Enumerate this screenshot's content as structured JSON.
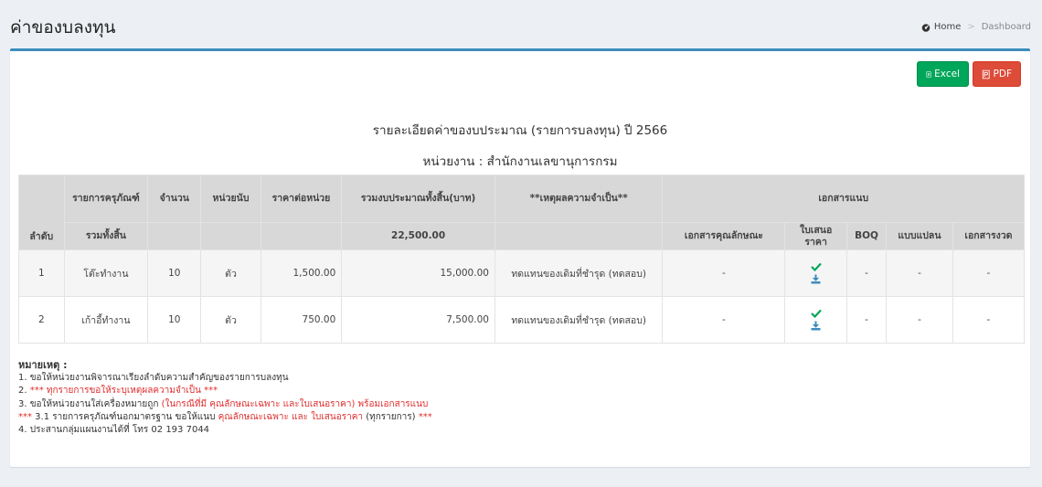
{
  "header": {
    "title": "ค่าของบลงทุน",
    "breadcrumb": [
      "Home",
      "Dashboard"
    ]
  },
  "actions": {
    "excel": "Excel",
    "pdf": "PDF"
  },
  "report": {
    "title": "รายละเอียดค่าของบประมาณ (รายการบลงทุน) ปี 2566",
    "unit": "หน่วยงาน : สำนักงานเลขานุการกรม"
  },
  "table": {
    "headers": {
      "item": "รายการครุภัณฑ์",
      "qty": "จำนวน",
      "unit": "หน่วยนับ",
      "price": "ราคาต่อหน่วย",
      "budget": "รวมงบประมาณทั้งสิ้น(บาท)",
      "reason": "**เหตุผลความจำเป็น**",
      "attachments": "เอกสารแนบ",
      "seq": "ลำดับ",
      "total_label": "รวมทั้งสิ้น",
      "total_value": "22,500.00",
      "doc_spec": "เอกสารคุณลักษณะ",
      "doc_quote": "ใบเสนอราคา",
      "doc_boq": "BOQ",
      "doc_plan": "แบบแปลน",
      "doc_other": "เอกสารงวด"
    },
    "rows": [
      {
        "seq": "1",
        "item": "โต๊ะทำงาน",
        "qty": "10",
        "unit": "ตัว",
        "price": "1,500.00",
        "budget": "15,000.00",
        "reason": "ทดแทนของเดิมที่ชำรุด (ทดสอบ)",
        "doc_spec": "-",
        "doc_boq": "-",
        "doc_plan": "-",
        "doc_other": "-"
      },
      {
        "seq": "2",
        "item": "เก้าอี้ทำงาน",
        "qty": "10",
        "unit": "ตัว",
        "price": "750.00",
        "budget": "7,500.00",
        "reason": "ทดแทนของเดิมที่ชำรุด (ทดสอบ)",
        "doc_spec": "-",
        "doc_boq": "-",
        "doc_plan": "-",
        "doc_other": "-"
      }
    ]
  },
  "notes": {
    "title": "หมายเหตุ :",
    "n1": "1. ขอให้หน่วยงานพิจารณาเรียงลำดับความสำคัญของรายการบลงทุน",
    "n2_prefix": "2. ",
    "n2_red": "*** ทุกรายการขอให้ระบุเหตุผลความจำเป็น ***",
    "n3_a": "3. ขอให้หน่วยงานใส่เครื่องหมายถูก ",
    "n3_red": "(ในกรณีที่มี คุณลักษณะเฉพาะ และใบเสนอราคา) พร้อมเอกสารแนบ",
    "n31_red1": "***",
    "n31_a": " 3.1 รายการครุภัณฑ์นอกมาตรฐาน ขอให้แนบ ",
    "n31_red2": "คุณลักษณะเฉพาะ และ ใบเสนอราคา",
    "n31_b": " (ทุกรายการ) ",
    "n31_red3": "***",
    "n4": "4. ประสานกลุ่มแผนงานได้ที่ โทร 02 193 7044"
  },
  "colors": {
    "accent": "#3c8dbc",
    "excel": "#00a65a",
    "pdf": "#dd4b39",
    "check": "#00a65a",
    "download": "#3c8dbc",
    "red_text": "#e02d2d"
  }
}
